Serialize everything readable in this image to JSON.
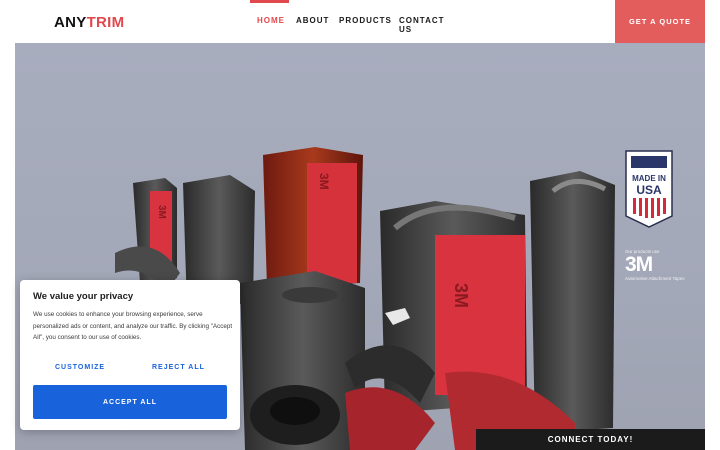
{
  "header": {
    "logo_part1": "ANY",
    "logo_part2": "TRIM",
    "nav": [
      {
        "label": "HOME",
        "active": true
      },
      {
        "label": "ABOUT",
        "active": false
      },
      {
        "label": "PRODUCTS",
        "active": false
      },
      {
        "label": "CONTACT US",
        "active": false
      }
    ],
    "cta_label": "GET A QUOTE"
  },
  "hero": {
    "badge": {
      "line1": "MADE IN",
      "line2": "USA"
    },
    "tape": {
      "caption_top": "Our products use",
      "brand": "3M",
      "caption_bottom": "Automotive Attachment Tapes"
    },
    "profile_print": "3M",
    "connect_label": "CONNECT TODAY!"
  },
  "cookie_banner": {
    "title": "We value your privacy",
    "text": "We use cookies to enhance your browsing experience, serve personalized ads or content, and analyze our traffic. By clicking \"Accept All\", you consent to our use of cookies.",
    "customize_label": "CUSTOMIZE",
    "reject_label": "REJECT ALL",
    "accept_label": "ACCEPT ALL"
  },
  "colors": {
    "brand_red": "#e0494d",
    "cta_red": "#e35d5d",
    "accept_blue": "#1863dc",
    "dark": "#1b1b1b"
  }
}
